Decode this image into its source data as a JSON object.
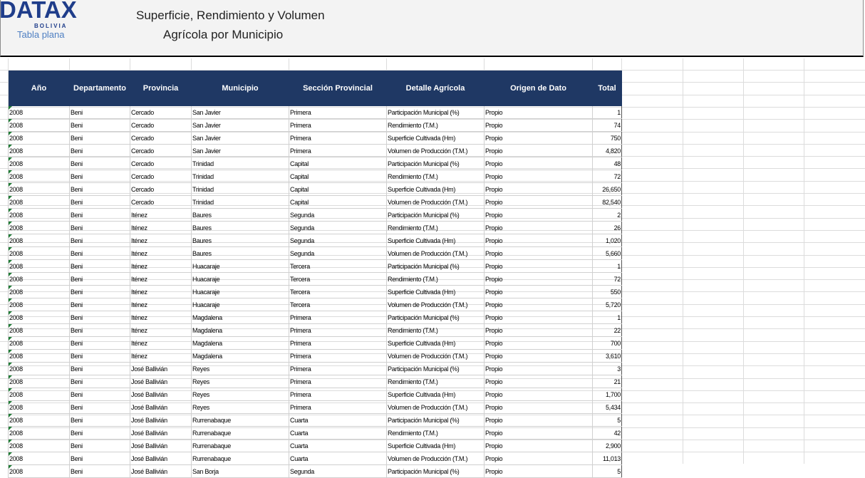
{
  "header": {
    "logo": "DATAX",
    "logo_sub": "BOLIVIA",
    "logo_tag": "Tabla plana",
    "title_line1": "Superficie, Rendimiento y Volumen",
    "title_line2": "Agrícola por Municipio"
  },
  "table": {
    "columns": [
      "Año",
      "Departamento",
      "Provincia",
      "Municipio",
      "Sección Provincial",
      "Detalle Agrícola",
      "Origen de Dato",
      "Total"
    ],
    "rows": [
      [
        "2008",
        "Beni",
        "Cercado",
        "San Javier",
        "Primera",
        "Participación Municipal (%)",
        "Propio",
        "1"
      ],
      [
        "2008",
        "Beni",
        "Cercado",
        "San Javier",
        "Primera",
        "Rendimiento (T.M.)",
        "Propio",
        "74"
      ],
      [
        "2008",
        "Beni",
        "Cercado",
        "San Javier",
        "Primera",
        "Superficie Cultivada (Hm)",
        "Propio",
        "750"
      ],
      [
        "2008",
        "Beni",
        "Cercado",
        "San Javier",
        "Primera",
        "Volumen de Producción (T.M.)",
        "Propio",
        "4,820"
      ],
      [
        "2008",
        "Beni",
        "Cercado",
        "Trinidad",
        "Capital",
        "Participación Municipal (%)",
        "Propio",
        "48"
      ],
      [
        "2008",
        "Beni",
        "Cercado",
        "Trinidad",
        "Capital",
        "Rendimiento (T.M.)",
        "Propio",
        "72"
      ],
      [
        "2008",
        "Beni",
        "Cercado",
        "Trinidad",
        "Capital",
        "Superficie Cultivada (Hm)",
        "Propio",
        "26,650"
      ],
      [
        "2008",
        "Beni",
        "Cercado",
        "Trinidad",
        "Capital",
        "Volumen de Producción (T.M.)",
        "Propio",
        "82,540"
      ],
      [
        "2008",
        "Beni",
        "Iténez",
        "Baures",
        "Segunda",
        "Participación Municipal (%)",
        "Propio",
        "2"
      ],
      [
        "2008",
        "Beni",
        "Iténez",
        "Baures",
        "Segunda",
        "Rendimiento (T.M.)",
        "Propio",
        "26"
      ],
      [
        "2008",
        "Beni",
        "Iténez",
        "Baures",
        "Segunda",
        "Superficie Cultivada (Hm)",
        "Propio",
        "1,020"
      ],
      [
        "2008",
        "Beni",
        "Iténez",
        "Baures",
        "Segunda",
        "Volumen de Producción (T.M.)",
        "Propio",
        "5,660"
      ],
      [
        "2008",
        "Beni",
        "Iténez",
        "Huacaraje",
        "Tercera",
        "Participación Municipal (%)",
        "Propio",
        "1"
      ],
      [
        "2008",
        "Beni",
        "Iténez",
        "Huacaraje",
        "Tercera",
        "Rendimiento (T.M.)",
        "Propio",
        "72"
      ],
      [
        "2008",
        "Beni",
        "Iténez",
        "Huacaraje",
        "Tercera",
        "Superficie Cultivada (Hm)",
        "Propio",
        "550"
      ],
      [
        "2008",
        "Beni",
        "Iténez",
        "Huacaraje",
        "Tercera",
        "Volumen de Producción (T.M.)",
        "Propio",
        "5,720"
      ],
      [
        "2008",
        "Beni",
        "Iténez",
        "Magdalena",
        "Primera",
        "Participación Municipal (%)",
        "Propio",
        "1"
      ],
      [
        "2008",
        "Beni",
        "Iténez",
        "Magdalena",
        "Primera",
        "Rendimiento (T.M.)",
        "Propio",
        "22"
      ],
      [
        "2008",
        "Beni",
        "Iténez",
        "Magdalena",
        "Primera",
        "Superficie Cultivada (Hm)",
        "Propio",
        "700"
      ],
      [
        "2008",
        "Beni",
        "Iténez",
        "Magdalena",
        "Primera",
        "Volumen de Producción (T.M.)",
        "Propio",
        "3,610"
      ],
      [
        "2008",
        "Beni",
        "José Ballivián",
        "Reyes",
        "Primera",
        "Participación Municipal (%)",
        "Propio",
        "3"
      ],
      [
        "2008",
        "Beni",
        "José Ballivián",
        "Reyes",
        "Primera",
        "Rendimiento (T.M.)",
        "Propio",
        "21"
      ],
      [
        "2008",
        "Beni",
        "José Ballivián",
        "Reyes",
        "Primera",
        "Superficie Cultivada (Hm)",
        "Propio",
        "1,700"
      ],
      [
        "2008",
        "Beni",
        "José Ballivián",
        "Reyes",
        "Primera",
        "Volumen de Producción (T.M.)",
        "Propio",
        "5,434"
      ],
      [
        "2008",
        "Beni",
        "José Ballivián",
        "Rurrenabaque",
        "Cuarta",
        "Participación Municipal (%)",
        "Propio",
        "5"
      ],
      [
        "2008",
        "Beni",
        "José Ballivián",
        "Rurrenabaque",
        "Cuarta",
        "Rendimiento (T.M.)",
        "Propio",
        "42"
      ],
      [
        "2008",
        "Beni",
        "José Ballivián",
        "Rurrenabaque",
        "Cuarta",
        "Superficie Cultivada (Hm)",
        "Propio",
        "2,900"
      ],
      [
        "2008",
        "Beni",
        "José Ballivián",
        "Rurrenabaque",
        "Cuarta",
        "Volumen de Producción (T.M.)",
        "Propio",
        "11,013"
      ],
      [
        "2008",
        "Beni",
        "José Ballivián",
        "San Borja",
        "Segunda",
        "Participación Municipal (%)",
        "Propio",
        "5"
      ]
    ]
  },
  "colors": {
    "header_bg": "#1f3864",
    "logo": "#1f3d8a",
    "indicator": "#1e7b34"
  }
}
